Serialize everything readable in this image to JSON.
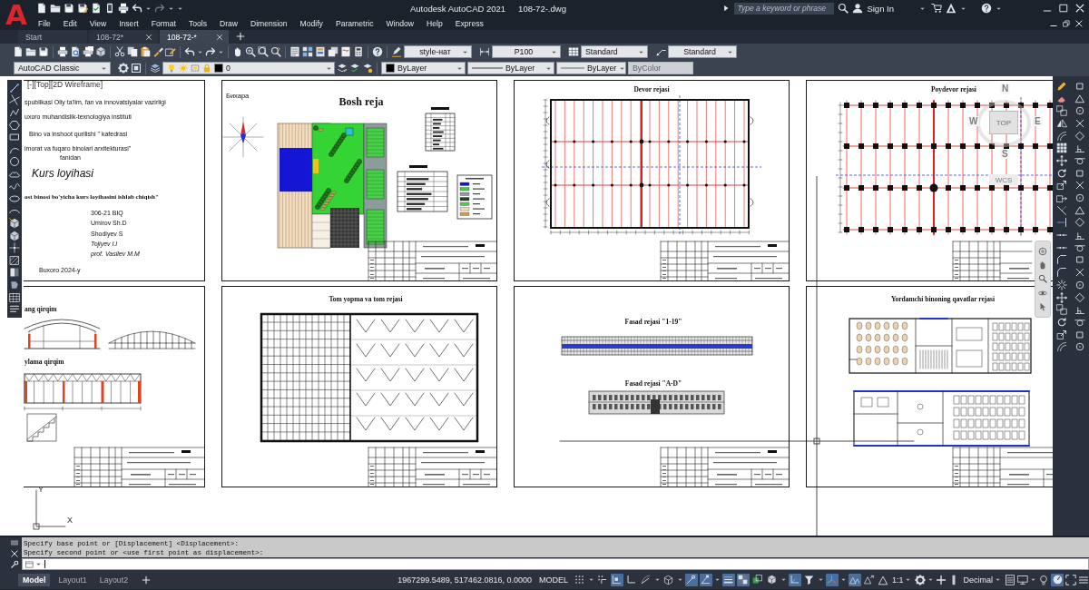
{
  "app": {
    "logo": "A",
    "title": "Autodesk AutoCAD 2021",
    "file": "108-72-.dwg",
    "search": {
      "placeholder": "Type a keyword or phrase"
    },
    "account": "Sign In"
  },
  "quick_access": {
    "redo": {
      "disabled": true
    }
  },
  "menu": [
    "File",
    "Edit",
    "View",
    "Insert",
    "Format",
    "Tools",
    "Draw",
    "Dimension",
    "Modify",
    "Parametric",
    "Window",
    "Help",
    "Express"
  ],
  "tabs": [
    {
      "label": "Start",
      "closable": false,
      "selected": false
    },
    {
      "label": "108-72*",
      "closable": true,
      "selected": false
    },
    {
      "label": "108-72-*",
      "closable": true,
      "selected": true
    }
  ],
  "toolbars": {
    "text_style": "style-нат",
    "dimension_style": "P100",
    "table_style": "Standard",
    "multileader_style": "Standard",
    "workspace": "AutoCAD Classic",
    "layer": "0",
    "object_color": "ByLayer",
    "linetype": "ByLayer",
    "lineweight": "ByLayer",
    "plot_style": {
      "value": "ByColor",
      "disabled": true
    }
  },
  "drawing": {
    "viewport_label": "[-][Top][2D Wireframe]",
    "sheets": [
      {
        "kind": "title_page",
        "title_block": false,
        "lines": [
          "spublikasi Oliy ta'lim, fan va innovatsiyalar vazirligi",
          "uxoro muhandislik-texnologiya instituti",
          "Bino va inshoot qurilishi \" kafedrasi",
          "imorat va fuqaro binolari arxitekturasi\"",
          "fanidan",
          "Kurs loyihasi",
          "ost binosi bo'yicha kurs loyihasini ishlab chiqish\"",
          "306-21 BIQ",
          "Umirov Sh.D",
          "Shodiyev S",
          "Tojiyev I.I",
          "prof. Vasilev M.M",
          "Buxoro 2024-y"
        ]
      },
      {
        "kind": "site_plan",
        "title": "Bosh reja",
        "caption": "Бихара",
        "title_block": true
      },
      {
        "kind": "wall_plan",
        "title": "Devor rejasi",
        "title_block": true
      },
      {
        "kind": "foundation_plan",
        "title": "Poydevor rejasi",
        "title_block": true
      },
      {
        "kind": "sections",
        "labels": [
          "ang qirqim",
          "ylama qirqim"
        ],
        "title_block": true
      },
      {
        "kind": "roof_plan",
        "title": "Tom yopma va tom rejasi",
        "title_block": true
      },
      {
        "kind": "facades",
        "labels": [
          "Fasad rejasi \"1-19\"",
          "Fasad rejasi \"A-D\""
        ],
        "title_block": true
      },
      {
        "kind": "floor_plans",
        "title": "Yordamchi binoning qavatlar rejasi",
        "title_block": true
      }
    ],
    "viewcube": {
      "face": "TOP",
      "north": "N",
      "west": "W",
      "east": "E",
      "south": "S",
      "ucs": "WCS"
    },
    "ucs": {
      "x": "X",
      "y": "Y"
    }
  },
  "command_line": {
    "history": [
      "Specify base point or [Displacement] <Displacement>:",
      "Specify second point or <use first point as displacement>:"
    ]
  },
  "layout_tabs": [
    {
      "label": "Model",
      "selected": true
    },
    {
      "label": "Layout1",
      "selected": false
    },
    {
      "label": "Layout2",
      "selected": false
    }
  ],
  "status_bar": {
    "coordinates": "1967299.5489, 517462.0816, 0.0000",
    "space": "MODEL",
    "annotation_scale": "1:1",
    "units": "Decimal",
    "toggles": [
      {
        "on": false
      },
      {
        "on": false
      },
      {
        "on": true
      },
      {
        "on": false
      },
      {
        "on": false
      },
      {
        "on": false
      },
      {
        "on": true
      },
      {
        "on": true
      },
      {
        "on": true
      },
      {
        "on": true
      },
      {
        "on": false
      },
      {
        "on": false
      },
      {
        "on": true
      },
      {
        "on": false
      },
      {
        "on": true
      },
      {
        "on": true
      },
      {
        "on": false
      },
      {
        "on": true
      }
    ]
  }
}
